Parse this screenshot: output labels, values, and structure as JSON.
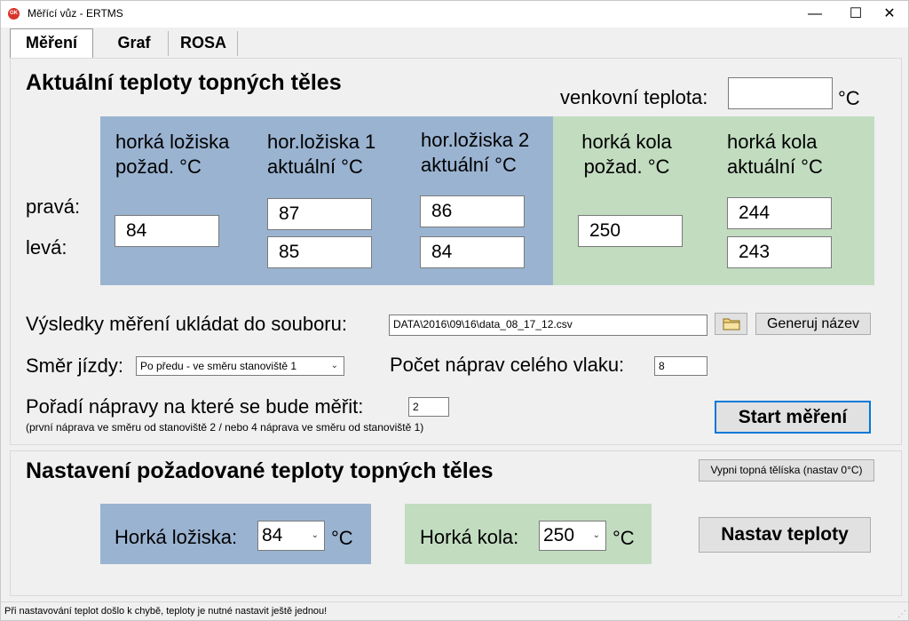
{
  "window": {
    "icon_text": "GK",
    "title": "Měřící vůz - ERTMS",
    "minimize": "—",
    "maximize": "☐",
    "close": "✕"
  },
  "tabs": [
    "Měření",
    "Graf",
    "ROSA"
  ],
  "measure": {
    "title": "Aktuální teploty topných těles",
    "outdoor_label": "venkovní teplota:",
    "outdoor_value": "",
    "outdoor_unit": "°C",
    "row_right": "pravá:",
    "row_left": "levá:",
    "columns": [
      {
        "line1": "horká ložiska",
        "line2": "požad. °C"
      },
      {
        "line1": "hor.ložiska 1",
        "line2": "aktuální °C"
      },
      {
        "line1": "hor.ložiska 2",
        "line2": "aktuální °C"
      },
      {
        "line1": "horká kola",
        "line2": "požad. °C"
      },
      {
        "line1": "horká kola",
        "line2": "aktuální °C"
      }
    ],
    "bearing_setpoint": "84",
    "bearing1_right": "87",
    "bearing1_left": "85",
    "bearing2_right": "86",
    "bearing2_left": "84",
    "wheel_setpoint": "250",
    "wheel_right": "244",
    "wheel_left": "243"
  },
  "file": {
    "label": "Výsledky měření ukládat do souboru:",
    "path": "DATA\\2016\\09\\16\\data_08_17_12.csv",
    "browse_icon": "folder-icon",
    "generate_label": "Generuj název"
  },
  "direction": {
    "label": "Směr jízdy:",
    "value": "Po předu - ve směru stanoviště 1",
    "axles_label": "Počet náprav celého vlaku:",
    "axles_value": "8"
  },
  "axle_order": {
    "label": "Pořadí nápravy na které se bude měřit:",
    "value": "2",
    "hint": "(první náprava ve směru od stanoviště 2 / nebo 4 náprava ve směru od stanoviště 1)"
  },
  "start_label": "Start měření",
  "setpoint": {
    "title": "Nastavení požadované teploty topných těles",
    "off_label": "Vypni topná tělíska (nastav 0°C)",
    "bearing_label": "Horká ložiska:",
    "bearing_value": "84",
    "wheel_label": "Horká kola:",
    "wheel_value": "250",
    "unit": "°C",
    "apply_label": "Nastav teploty"
  },
  "status": "Při nastavování teplot došlo k chybě, teploty je nutné nastavit ještě jednou!",
  "colors": {
    "bearing_panel": "#9ab3d1",
    "wheel_panel": "#c2dcc0",
    "default_button_border": "#0078d7"
  }
}
